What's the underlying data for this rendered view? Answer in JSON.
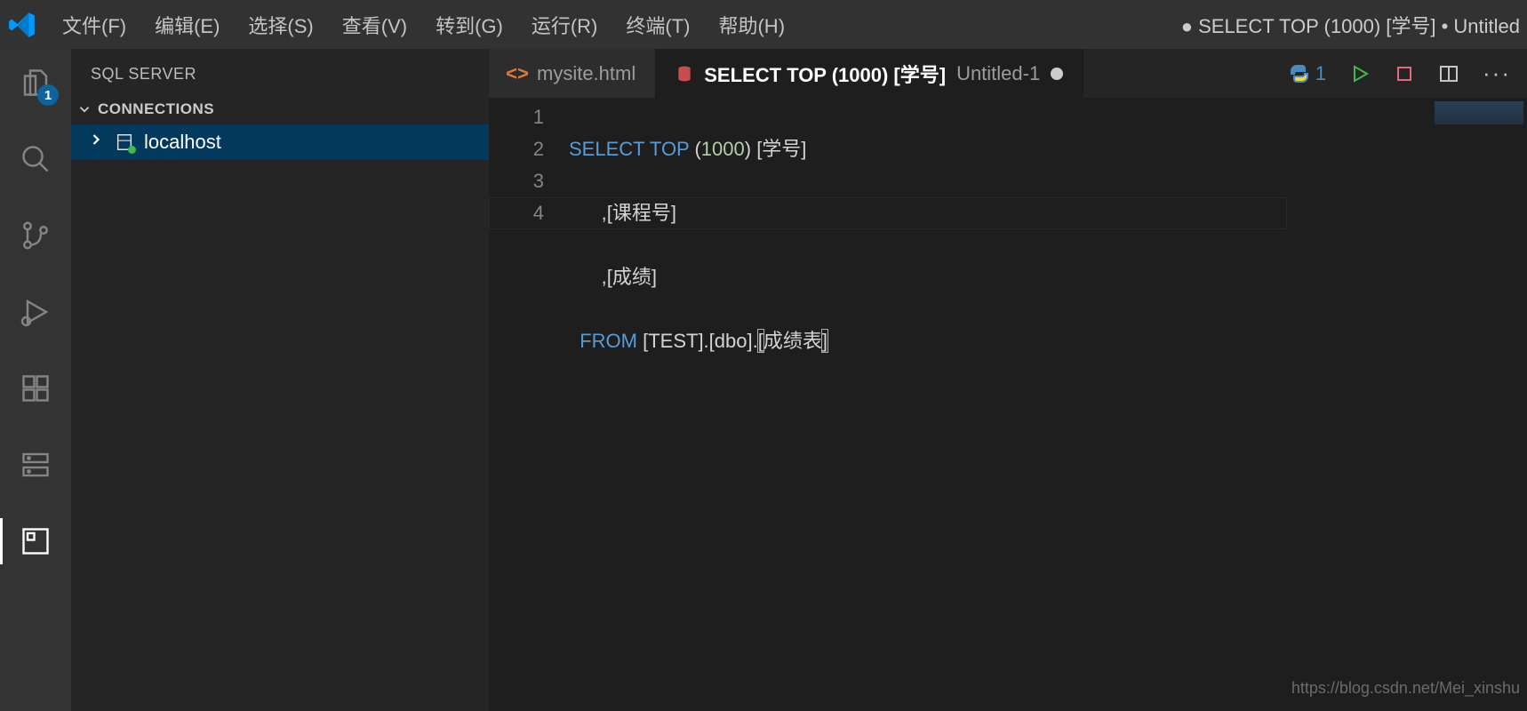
{
  "titlebar": {
    "menus": [
      "文件(F)",
      "编辑(E)",
      "选择(S)",
      "查看(V)",
      "转到(G)",
      "运行(R)",
      "终端(T)",
      "帮助(H)"
    ],
    "window_title": "● SELECT TOP (1000) [学号] • Untitled"
  },
  "activity": {
    "items": [
      {
        "name": "explorer-icon",
        "badge": "1",
        "active": false
      },
      {
        "name": "search-icon"
      },
      {
        "name": "source-control-icon"
      },
      {
        "name": "run-debug-icon"
      },
      {
        "name": "extensions-icon"
      },
      {
        "name": "sql-server-icon"
      },
      {
        "name": "sql-panel-icon",
        "active": true
      }
    ]
  },
  "sidebar": {
    "title": "SQL SERVER",
    "section": "CONNECTIONS",
    "tree": [
      {
        "label": "localhost"
      }
    ]
  },
  "tabs": {
    "items": [
      {
        "icon": "html-icon",
        "label": "mysite.html",
        "active": false,
        "dirty": false
      },
      {
        "icon": "database-icon",
        "label": "SELECT TOP (1000) [学号]",
        "sublabel": "Untitled-1",
        "active": true,
        "dirty": true
      }
    ],
    "actions": {
      "python_badge": "1"
    }
  },
  "code": {
    "line_numbers": [
      "1",
      "2",
      "3",
      "4"
    ],
    "l1": {
      "a": "SELECT",
      "b": "TOP",
      "c": "(",
      "d": "1000",
      "e": ")",
      "f": " [学号]"
    },
    "l2": "      ,[课程号]",
    "l3": "      ,[成绩]",
    "l4": {
      "a": "  FROM",
      "b": " [TEST].[dbo].",
      "c": "[",
      "d": "成绩表",
      "e": "]"
    }
  },
  "watermark": "https://blog.csdn.net/Mei_xinshu"
}
